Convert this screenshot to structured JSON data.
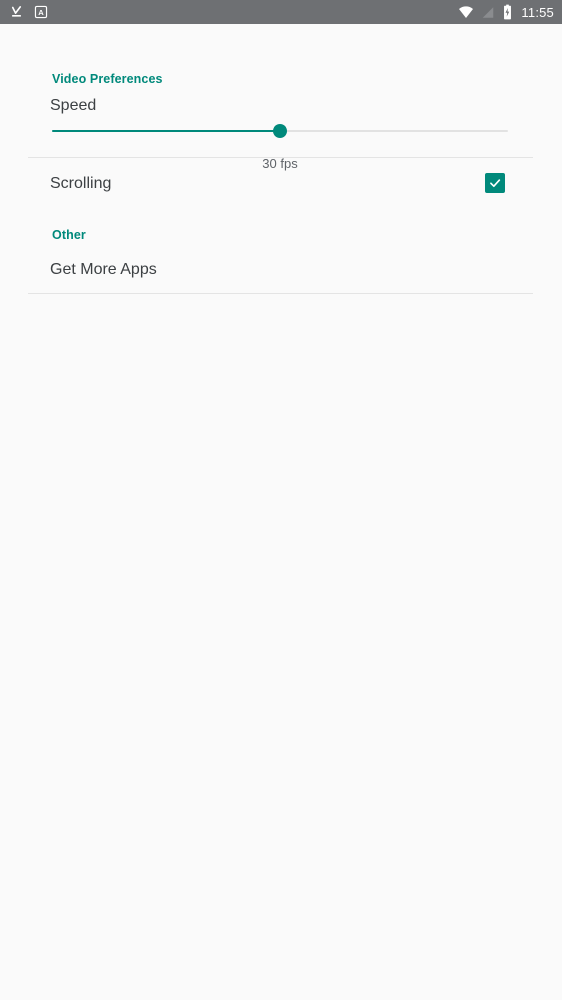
{
  "status_bar": {
    "background_color": "#6E7073",
    "left_icons": [
      {
        "name": "download-complete-icon",
        "glyph": "check-down"
      },
      {
        "name": "keyboard-input-icon",
        "glyph": "letter-A"
      }
    ],
    "right_icons": [
      {
        "name": "wifi-icon",
        "glyph": "wifi"
      },
      {
        "name": "cellular-signal-off-icon",
        "glyph": "signal-none"
      },
      {
        "name": "battery-charging-icon",
        "glyph": "battery-bolt"
      }
    ],
    "time": "11:55"
  },
  "theme": {
    "accent_color": "#00897B",
    "page_background": "#FAFAFA",
    "primary_text_color": "#3C4043",
    "secondary_text_color": "#5F6368",
    "divider_color": "#E4E4E4",
    "slider_track_color": "#E2E2E2"
  },
  "settings": {
    "sections": [
      {
        "header": "Video Preferences",
        "items": [
          {
            "type": "slider",
            "title": "Speed",
            "value_label": "30 fps",
            "value": 30,
            "percent": 50
          },
          {
            "type": "checkbox",
            "title": "Scrolling",
            "checked": true
          }
        ]
      },
      {
        "header": "Other",
        "items": [
          {
            "type": "link",
            "title": "Get More Apps"
          }
        ]
      }
    ]
  }
}
